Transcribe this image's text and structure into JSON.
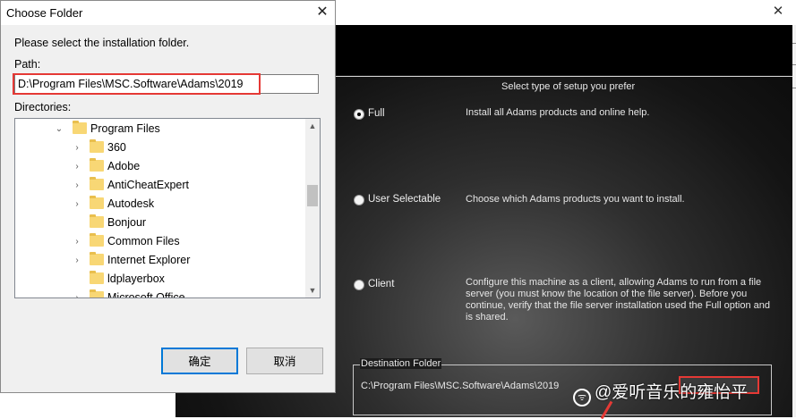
{
  "installer": {
    "setup_caption": "Select type of setup you prefer",
    "options": [
      {
        "label": "Full",
        "selected": true,
        "description": "Install all Adams products and online help."
      },
      {
        "label": "User Selectable",
        "selected": false,
        "description": "Choose which Adams products you want to install."
      },
      {
        "label": "Client",
        "selected": false,
        "description": "Configure this machine as a client, allowing Adams to run from a file server (you must know the location of the file server). Before you continue, verify that the file server installation used the Full option and is shared."
      }
    ],
    "destination_legend": "Destination Folder",
    "destination_path": "C:\\Program Files\\MSC.Software\\Adams\\2019",
    "close_glyph": "✕"
  },
  "dialog": {
    "title": "Choose Folder",
    "close_glyph": "✕",
    "instruction": "Please select the installation folder.",
    "path_label": "Path:",
    "path_value": "D:\\Program Files\\MSC.Software\\Adams\\2019",
    "directories_label": "Directories:",
    "tree": [
      {
        "label": "Program Files",
        "expanded": true
      },
      {
        "label": "360",
        "has_children": true
      },
      {
        "label": "Adobe",
        "has_children": true
      },
      {
        "label": "AntiCheatExpert",
        "has_children": true
      },
      {
        "label": "Autodesk",
        "has_children": true
      },
      {
        "label": "Bonjour",
        "has_children": false
      },
      {
        "label": "Common Files",
        "has_children": true
      },
      {
        "label": "Internet Explorer",
        "has_children": true
      },
      {
        "label": "ldplayerbox",
        "has_children": false
      },
      {
        "label": "Microsoft Office",
        "has_children": true
      }
    ],
    "ok_label": "确定",
    "cancel_label": "取消"
  },
  "watermark": {
    "text": "@爱听音乐的雍怡平",
    "logo_glyph": "ᯤ"
  },
  "colors": {
    "highlight_red": "#e53935",
    "focus_blue": "#0078d7",
    "folder_yellow": "#f8d775"
  },
  "icons": [
    "close-icon",
    "radio-icon",
    "folder-icon",
    "chevron-down-icon",
    "chevron-right-icon",
    "scroll-up-icon",
    "scroll-down-icon",
    "weibo-logo-icon"
  ]
}
